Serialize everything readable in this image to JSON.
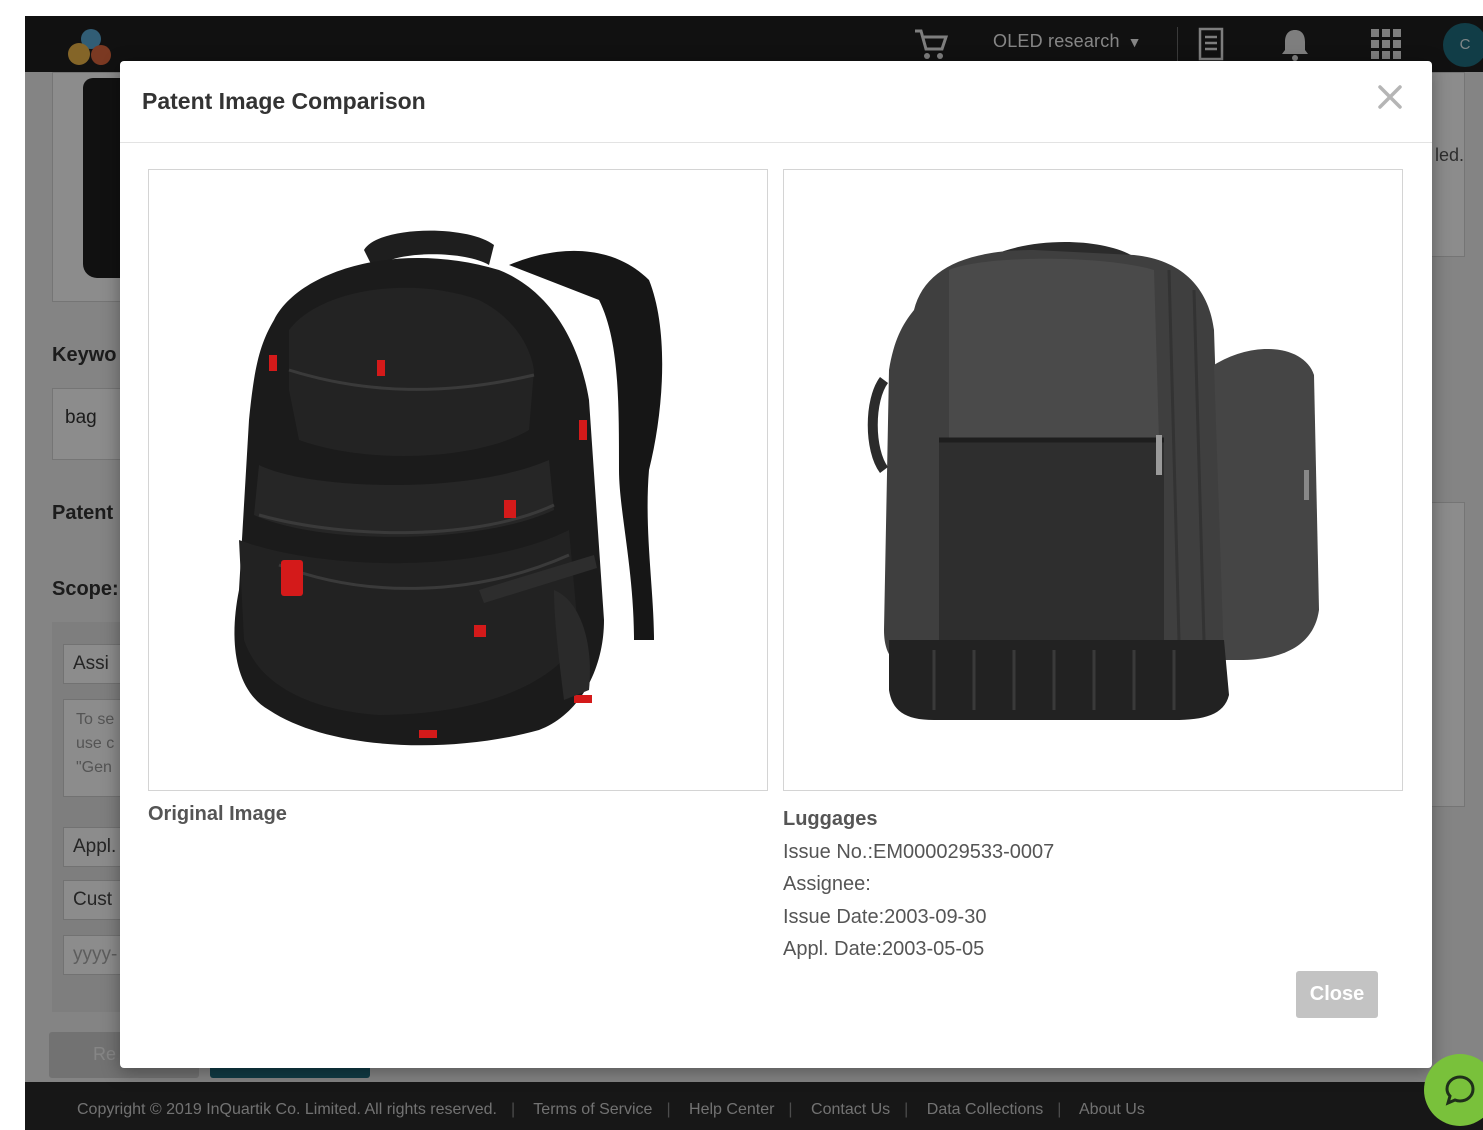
{
  "topbar": {
    "project": "OLED research",
    "user_initial": "C"
  },
  "background": {
    "keyword_label": "Keywo",
    "keyword_value": "bag",
    "patent_label": "Patent",
    "scope_label": "Scope:",
    "assignee_field": "Assi",
    "note_lines": [
      "To se",
      "use c",
      "\"Gen"
    ],
    "appl_field": "Appl.",
    "custom_field": "Cust",
    "date_placeholder": "yyyy-",
    "reset_label": "Re",
    "notice_text": "led."
  },
  "modal": {
    "title": "Patent Image Comparison",
    "original_caption": "Original Image",
    "result": {
      "title": "Luggages",
      "issue_no": "Issue No.:EM000029533-0007",
      "assignee": "Assignee:",
      "issue_date": "Issue Date:2003-09-30",
      "appl_date": "Appl. Date:2003-05-05"
    },
    "close_button": "Close"
  },
  "footer": {
    "copyright": "Copyright © 2019 InQuartik Co. Limited. All rights reserved.",
    "links": [
      "Terms of Service",
      "Help Center",
      "Contact Us",
      "Data Collections",
      "About Us"
    ]
  },
  "colors": {
    "topbar": "#202020",
    "accent_teal": "#1e6c7e",
    "chat_green": "#79c13b",
    "backpack_red": "#d41a1a"
  },
  "icons": [
    "logo",
    "cart-icon",
    "caret-down-icon",
    "document-icon",
    "bell-icon",
    "apps-grid-icon",
    "close-icon",
    "chat-icon"
  ]
}
